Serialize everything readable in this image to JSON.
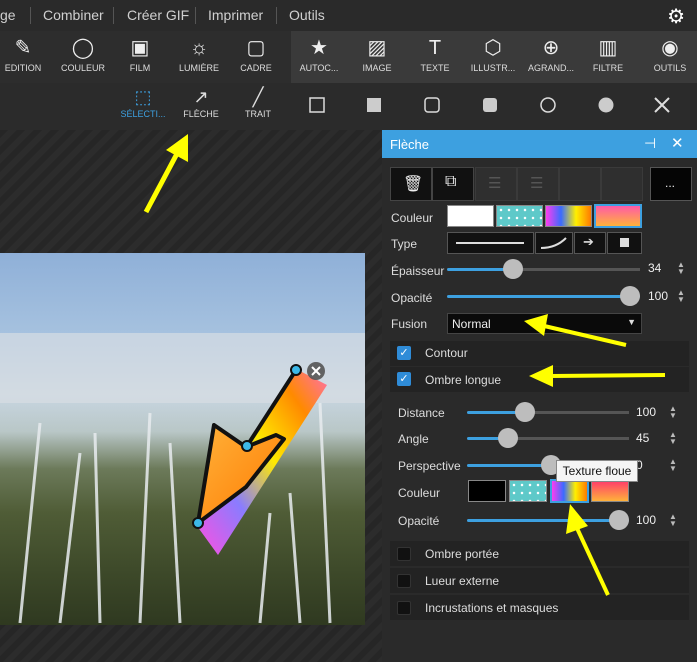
{
  "menu": {
    "items": [
      "ge",
      "Combiner",
      "Créer GIF",
      "Imprimer",
      "Outils"
    ]
  },
  "toolbar": {
    "items": [
      {
        "label": "EDITION",
        "icon": "edit-icon"
      },
      {
        "label": "COULEUR",
        "icon": "circle-icon"
      },
      {
        "label": "FILM",
        "icon": "film-icon"
      },
      {
        "label": "LUMIÈRE",
        "icon": "sun-icon"
      },
      {
        "label": "CADRE",
        "icon": "frame-icon"
      },
      {
        "label": "AUTOC...",
        "icon": "sticker-icon"
      },
      {
        "label": "IMAGE",
        "icon": "image-icon"
      },
      {
        "label": "TEXTE",
        "icon": "text-icon"
      },
      {
        "label": "ILLUSTR...",
        "icon": "illustration-icon"
      },
      {
        "label": "AGRAND...",
        "icon": "zoom-icon"
      },
      {
        "label": "FILTRE",
        "icon": "filter-icon"
      },
      {
        "label": "OUTILS",
        "icon": "palette-icon"
      }
    ]
  },
  "subtoolbar": {
    "selection_label": "SÉLECTI...",
    "arrow_label": "FLÈCHE",
    "line_label": "TRAIT"
  },
  "panel": {
    "title": "Flèche",
    "couleur_label": "Couleur",
    "type_label": "Type",
    "epaisseur_label": "Épaisseur",
    "epaisseur_value": "34",
    "opacite_label": "Opacité",
    "opacite_value": "100",
    "fusion_label": "Fusion",
    "fusion_value": "Normal",
    "contour_label": "Contour",
    "ombre_longue_label": "Ombre longue",
    "distance_label": "Distance",
    "distance_value": "100",
    "angle_label": "Angle",
    "angle_value": "45",
    "perspective_label": "Perspective",
    "perspective_value": "0",
    "couleur2_label": "Couleur",
    "opacite2_label": "Opacité",
    "opacite2_value": "100",
    "ombre_portee_label": "Ombre portée",
    "lueur_label": "Lueur externe",
    "incrustations_label": "Incrustations et masques",
    "more_label": "...",
    "tooltip": "Texture floue"
  },
  "slider_levels": {
    "epaisseur": 0.34,
    "opacite": 1.0,
    "distance": 0.36,
    "angle": 0.25,
    "perspective": 0.52,
    "opacite2": 1.0
  },
  "colors": {
    "accent": "#3da0e0",
    "annotation_arrow": "#ffff00"
  }
}
